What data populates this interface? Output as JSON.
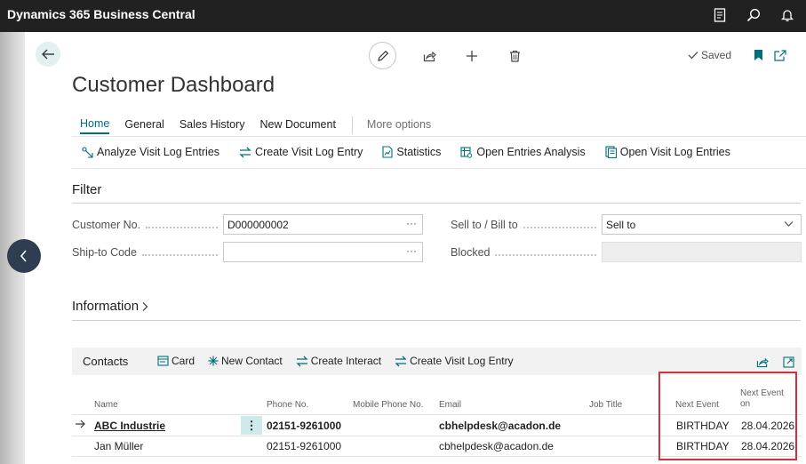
{
  "app": {
    "title": "Dynamics 365 Business Central"
  },
  "top_icons": [
    "report-icon",
    "search-icon",
    "bell-icon"
  ],
  "header": {
    "saved_label": "Saved",
    "page_title": "Customer Dashboard"
  },
  "tabs": [
    {
      "label": "Home",
      "active": true
    },
    {
      "label": "General",
      "active": false
    },
    {
      "label": "Sales History",
      "active": false
    },
    {
      "label": "New Document",
      "active": false
    },
    {
      "label": "More options",
      "active": false
    }
  ],
  "actions": [
    {
      "label": "Analyze Visit Log Entries",
      "icon": "analyze-icon"
    },
    {
      "label": "Create Visit Log Entry",
      "icon": "swap-arrows-icon"
    },
    {
      "label": "Statistics",
      "icon": "document-chart-icon"
    },
    {
      "label": "Open Entries Analysis",
      "icon": "table-analysis-icon"
    },
    {
      "label": "Open Visit Log Entries",
      "icon": "document-list-icon"
    }
  ],
  "filter": {
    "title": "Filter",
    "customer_no": {
      "label": "Customer No.",
      "value": "D000000002"
    },
    "ship_to_code": {
      "label": "Ship-to Code",
      "value": ""
    },
    "sell_to_bill_to": {
      "label": "Sell to / Bill to",
      "value": "Sell to"
    },
    "blocked": {
      "label": "Blocked",
      "value": ""
    }
  },
  "information": {
    "title": "Information"
  },
  "contacts": {
    "title": "Contacts",
    "actions": [
      {
        "label": "Card",
        "icon": "card-icon"
      },
      {
        "label": "New Contact",
        "icon": "sparkle-icon"
      },
      {
        "label": "Create Interact",
        "icon": "swap-arrows-icon"
      },
      {
        "label": "Create Visit Log Entry",
        "icon": "swap-arrows-icon"
      }
    ],
    "columns": {
      "name": "Name",
      "phone": "Phone No.",
      "mobile": "Mobile Phone No.",
      "email": "Email",
      "job_title": "Job Title",
      "next_event": "Next Event",
      "next_event_on_1": "Next Event",
      "next_event_on_2": "on"
    },
    "rows": [
      {
        "name": "ABC Industrie",
        "phone": "02151-9261000",
        "mobile": "",
        "email": "cbhelpdesk@acadon.de",
        "job_title": "",
        "next_event": "BIRTHDAY",
        "next_event_on": "28.04.2026"
      },
      {
        "name": "Jan Müller",
        "phone": "02151-9261000",
        "mobile": "",
        "email": "cbhelpdesk@acadon.de",
        "job_title": "",
        "next_event": "BIRTHDAY",
        "next_event_on": "28.04.2026"
      }
    ]
  },
  "colors": {
    "accent": "#00707a",
    "highlight": "#d2303a",
    "topbar": "#212121"
  }
}
